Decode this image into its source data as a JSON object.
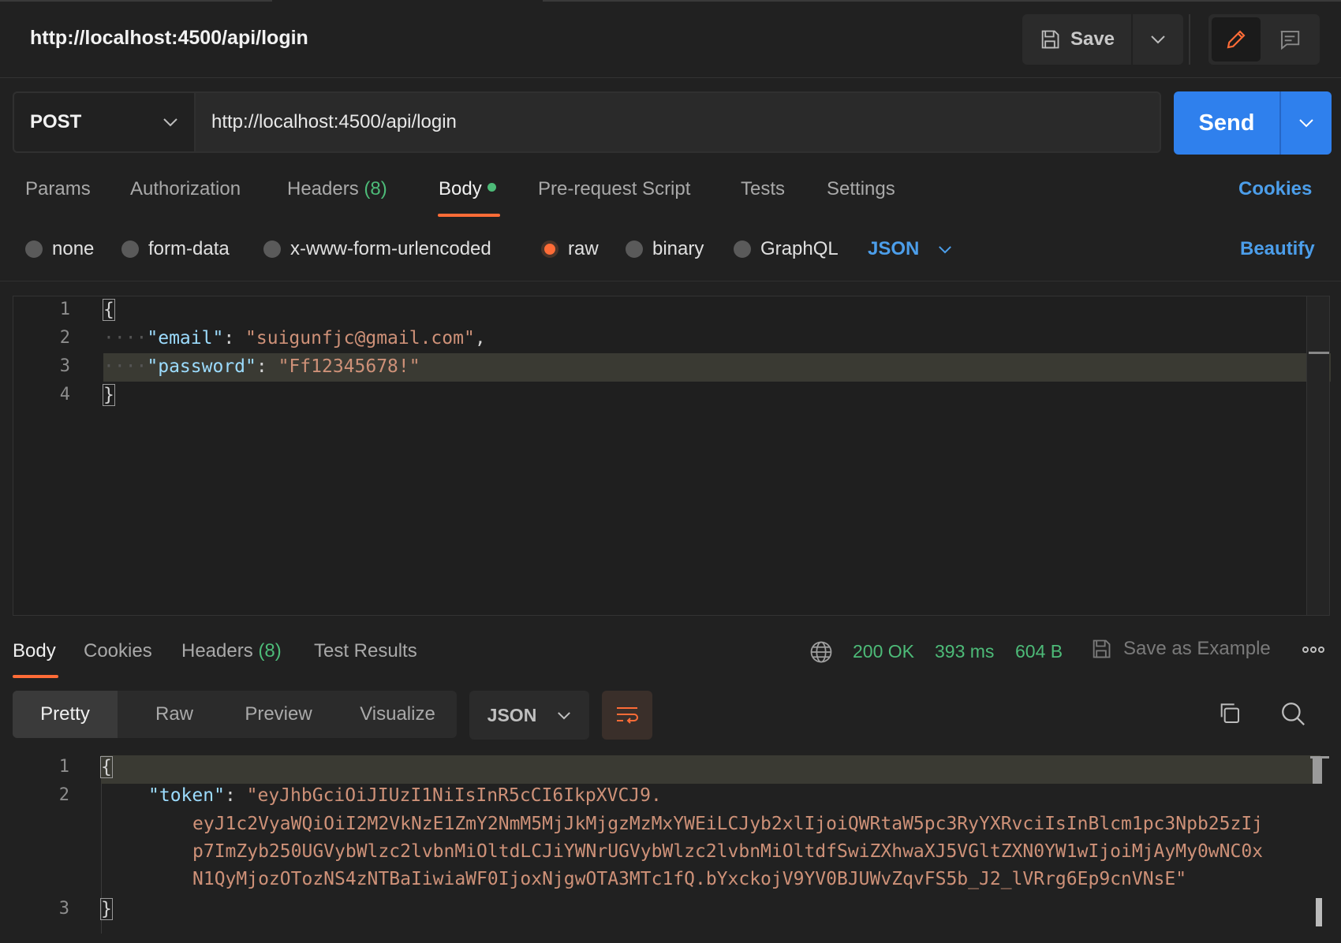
{
  "header": {
    "title": "http://localhost:4500/api/login",
    "save_label": "Save"
  },
  "request": {
    "method": "POST",
    "url": "http://localhost:4500/api/login",
    "send_label": "Send",
    "tabs": [
      {
        "label": "Params"
      },
      {
        "label": "Authorization"
      },
      {
        "label": "Headers",
        "count": "(8)"
      },
      {
        "label": "Body"
      },
      {
        "label": "Pre-request Script"
      },
      {
        "label": "Tests"
      },
      {
        "label": "Settings"
      }
    ],
    "cookies_label": "Cookies",
    "body_types": [
      "none",
      "form-data",
      "x-www-form-urlencoded",
      "raw",
      "binary",
      "GraphQL"
    ],
    "selected_body_type": "raw",
    "format": "JSON",
    "beautify_label": "Beautify",
    "body_lines": {
      "n1": "1",
      "n2": "2",
      "n3": "3",
      "n4": "4",
      "open": "{",
      "close": "}",
      "email_key": "\"email\"",
      "email_value": "\"suigunfjc@gmail.com\"",
      "password_key": "\"password\"",
      "password_value": "\"Ff12345678!\""
    }
  },
  "response": {
    "tabs": [
      {
        "label": "Body"
      },
      {
        "label": "Cookies"
      },
      {
        "label": "Headers",
        "count": "(8)"
      },
      {
        "label": "Test Results"
      }
    ],
    "status": "200 OK",
    "time": "393 ms",
    "size": "604 B",
    "save_example_label": "Save as Example",
    "view_modes": [
      "Pretty",
      "Raw",
      "Preview",
      "Visualize"
    ],
    "format": "JSON",
    "body_lines": {
      "n1": "1",
      "n2": "2",
      "n3": "3",
      "open": "{",
      "close": "}",
      "token_key": "\"token\"",
      "token_line1": "\"eyJhbGciOiJIUzI1NiIsInR5cCI6IkpXVCJ9.",
      "token_line2": "eyJ1c2VyaWQiOiI2M2VkNzE1ZmY2NmM5MjJkMjgzMzMxYWEiLCJyb2xlIjoiQWRtaW5pc3RyYXRvciIsInBlcm1pc3Npb25zIj",
      "token_line3": "p7ImZyb250UGVybWlzc2lvbnMiOltdLCJiYWNrUGVybWlzc2lvbnMiOltdfSwiZXhwaXJ5VGltZXN0YW1wIjoiMjAyMy0wNC0x",
      "token_line4": "N1QyMjozOTozNS4zNTBaIiwiaWF0IjoxNjgwOTA3MTc1fQ.bYxckojV9YV0BJUWvZqvFS5b_J2_lVRrg6Ep9cnVNsE\""
    }
  },
  "colors": {
    "accent_orange": "#ff6c37",
    "send_blue": "#2f80ed",
    "link_blue": "#4c9eea",
    "status_green": "#4dbb78"
  },
  "icons": [
    "save-icon",
    "chevron-down-icon",
    "pencil-icon",
    "comment-icon",
    "globe-icon",
    "copy-icon",
    "search-icon",
    "wrap-lines-icon",
    "more-icon"
  ]
}
